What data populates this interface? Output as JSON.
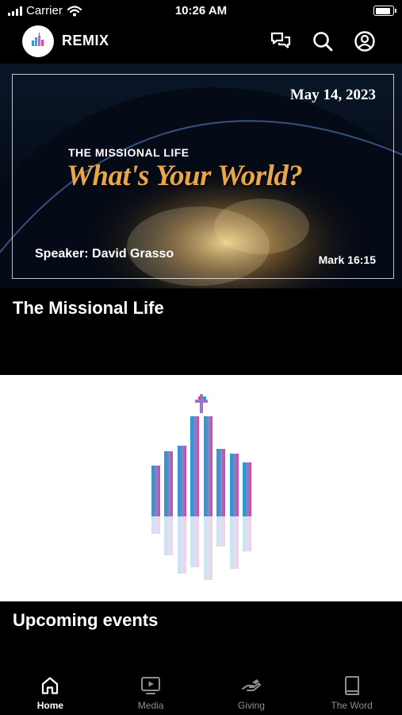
{
  "status_bar": {
    "carrier": "Carrier",
    "time": "10:26 AM",
    "battery_level": 1.0
  },
  "header": {
    "app_name": "REMIX",
    "icons": [
      "chat-icon",
      "search-icon",
      "profile-icon"
    ]
  },
  "hero": {
    "date": "May 14, 2023",
    "series_label": "THE MISSIONAL LIFE",
    "headline": "What's Your World?",
    "speaker": "Speaker: David Grasso",
    "scripture": "Mark 16:15"
  },
  "sections": {
    "series_title": "The Missional Life",
    "events_title": "Upcoming events"
  },
  "tabs": [
    {
      "label": "Home",
      "icon": "home-icon",
      "active": true
    },
    {
      "label": "Media",
      "icon": "media-icon",
      "active": false
    },
    {
      "label": "Giving",
      "icon": "giving-icon",
      "active": false
    },
    {
      "label": "The Word",
      "icon": "book-icon",
      "active": false
    }
  ],
  "colors": {
    "background": "#000000",
    "headline": "#e8a54c",
    "tab_active": "#ffffff",
    "tab_inactive": "#8e8e8e",
    "logo_gradient": [
      "#1ea2d8",
      "#3f8ed0",
      "#8a86c4",
      "#b45db5",
      "#e0439b"
    ]
  }
}
